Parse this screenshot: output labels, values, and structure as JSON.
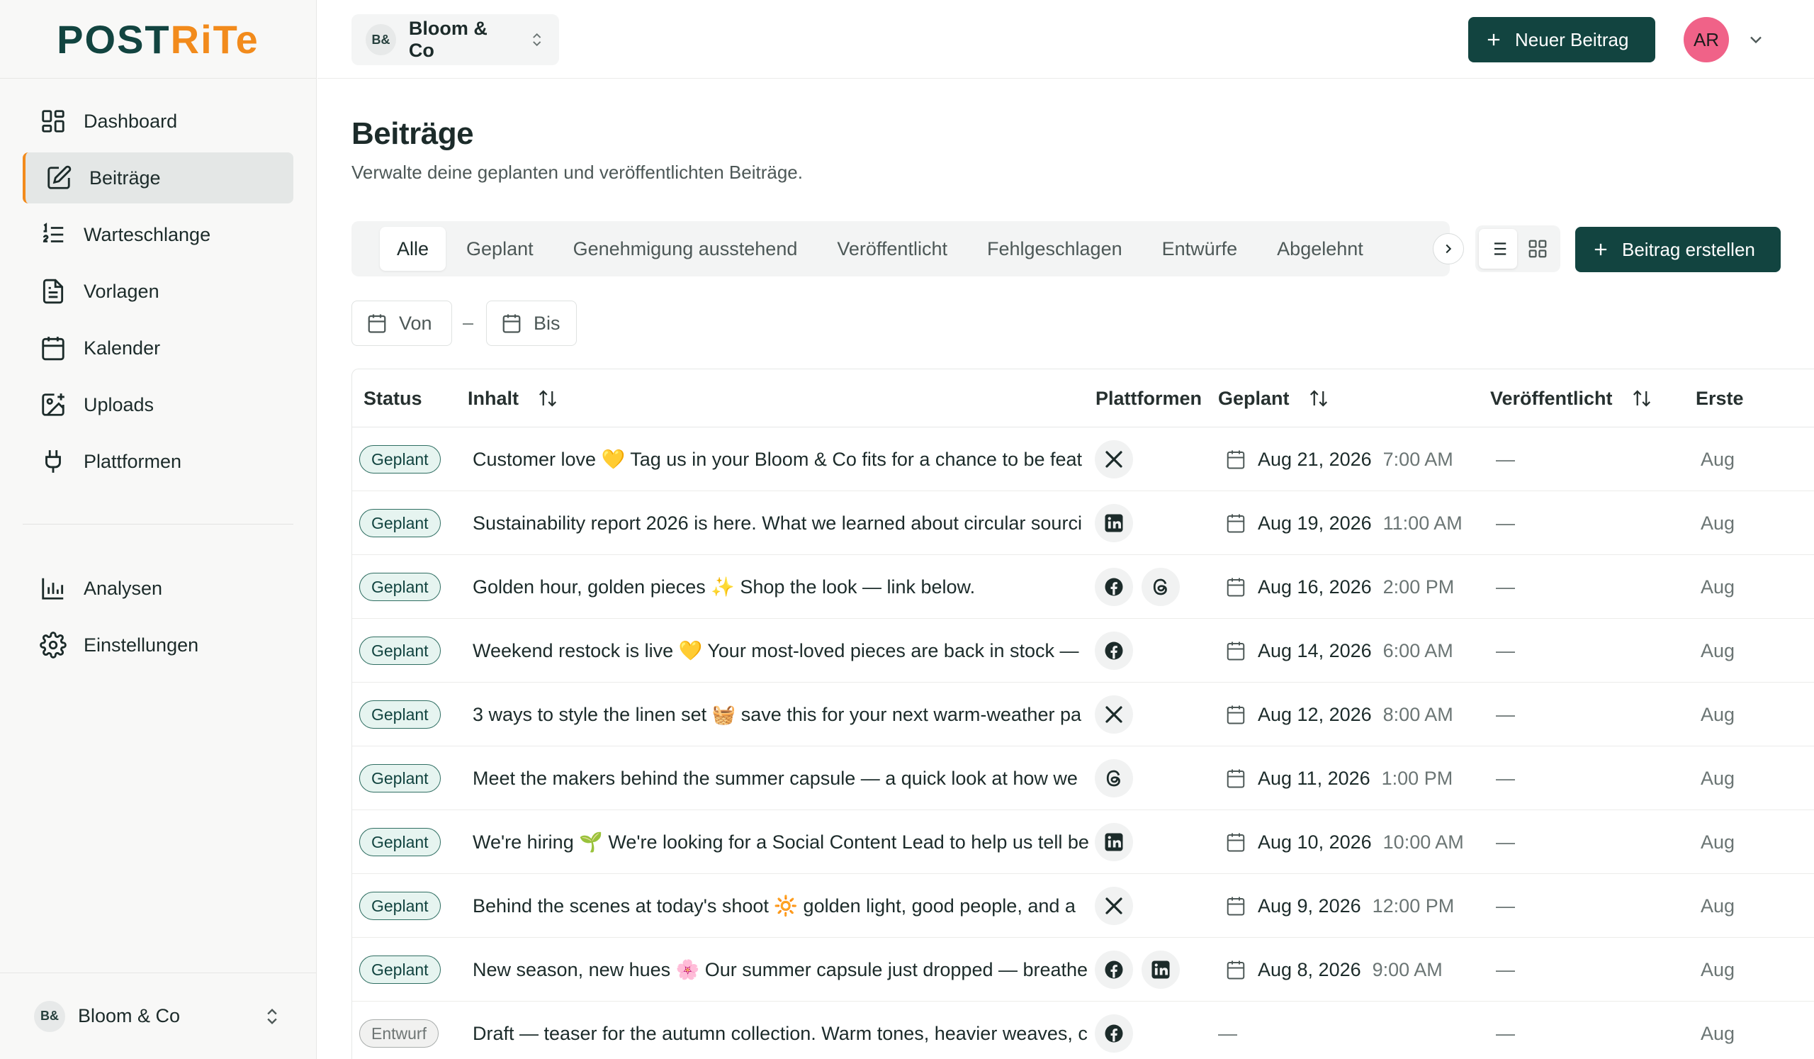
{
  "app": {
    "logo_post": "POST",
    "logo_rite": "RiTe",
    "workspace_badge": "B&",
    "workspace_name": "Bloom & Co"
  },
  "sidebar": {
    "items": [
      {
        "label": "Dashboard",
        "icon": "dashboard-icon"
      },
      {
        "label": "Beiträge",
        "icon": "edit-icon",
        "active": true
      },
      {
        "label": "Warteschlange",
        "icon": "queue-icon"
      },
      {
        "label": "Vorlagen",
        "icon": "document-icon"
      },
      {
        "label": "Kalender",
        "icon": "calendar-icon"
      },
      {
        "label": "Uploads",
        "icon": "image-icon"
      },
      {
        "label": "Plattformen",
        "icon": "plug-icon"
      }
    ],
    "secondary": [
      {
        "label": "Analysen",
        "icon": "chart-icon"
      },
      {
        "label": "Einstellungen",
        "icon": "gear-icon"
      }
    ]
  },
  "header": {
    "new_post_label": "Neuer Beitrag",
    "avatar_initials": "AR"
  },
  "page": {
    "title": "Beiträge",
    "subtitle": "Verwalte deine geplanten und veröffentlichten Beiträge."
  },
  "tabs": [
    "Alle",
    "Geplant",
    "Genehmigung ausstehend",
    "Veröffentlicht",
    "Fehlgeschlagen",
    "Entwürfe",
    "Abgelehnt"
  ],
  "actions": {
    "create_post_label": "Beitrag erstellen"
  },
  "filters": {
    "from_label": "Von",
    "to_label": "Bis",
    "separator": "–"
  },
  "table": {
    "headers": {
      "status": "Status",
      "content": "Inhalt",
      "platforms": "Plattformen",
      "scheduled": "Geplant",
      "published": "Veröffentlicht",
      "created": "Erste"
    },
    "rows": [
      {
        "status": "Geplant",
        "status_type": "scheduled",
        "content": "Customer love 💛  Tag us in your Bloom & Co fits for a chance to be feat",
        "platforms": [
          "x"
        ],
        "date": "Aug 21, 2026",
        "time": "7:00 AM",
        "published": "—",
        "created": "Aug"
      },
      {
        "status": "Geplant",
        "status_type": "scheduled",
        "content": "Sustainability report 2026 is here. What we learned about circular sourci",
        "platforms": [
          "linkedin"
        ],
        "date": "Aug 19, 2026",
        "time": "11:00 AM",
        "published": "—",
        "created": "Aug"
      },
      {
        "status": "Geplant",
        "status_type": "scheduled",
        "content": "Golden hour, golden pieces ✨  Shop the look — link below.",
        "platforms": [
          "facebook",
          "threads"
        ],
        "date": "Aug 16, 2026",
        "time": "2:00 PM",
        "published": "—",
        "created": "Aug"
      },
      {
        "status": "Geplant",
        "status_type": "scheduled",
        "content": "Weekend restock is live 💛  Your most-loved pieces are back in stock —",
        "platforms": [
          "facebook"
        ],
        "date": "Aug 14, 2026",
        "time": "6:00 AM",
        "published": "—",
        "created": "Aug"
      },
      {
        "status": "Geplant",
        "status_type": "scheduled",
        "content": "3 ways to style the linen set 🧺  save this for your next warm-weather pa",
        "platforms": [
          "x"
        ],
        "date": "Aug 12, 2026",
        "time": "8:00 AM",
        "published": "—",
        "created": "Aug"
      },
      {
        "status": "Geplant",
        "status_type": "scheduled",
        "content": "Meet the makers behind the summer capsule — a quick look at how we",
        "platforms": [
          "threads"
        ],
        "date": "Aug 11, 2026",
        "time": "1:00 PM",
        "published": "—",
        "created": "Aug"
      },
      {
        "status": "Geplant",
        "status_type": "scheduled",
        "content": "We're hiring 🌱  We're looking for a Social Content Lead to help us tell be",
        "platforms": [
          "linkedin"
        ],
        "date": "Aug 10, 2026",
        "time": "10:00 AM",
        "published": "—",
        "created": "Aug"
      },
      {
        "status": "Geplant",
        "status_type": "scheduled",
        "content": "Behind the scenes at today's shoot 🔆  golden light, good people, and a",
        "platforms": [
          "x"
        ],
        "date": "Aug 9, 2026",
        "time": "12:00 PM",
        "published": "—",
        "created": "Aug"
      },
      {
        "status": "Geplant",
        "status_type": "scheduled",
        "content": "New season, new hues 🌸  Our summer capsule just dropped — breathe",
        "platforms": [
          "facebook",
          "linkedin"
        ],
        "date": "Aug 8, 2026",
        "time": "9:00 AM",
        "published": "—",
        "created": "Aug"
      },
      {
        "status": "Entwurf",
        "status_type": "draft",
        "content": "Draft — teaser for the autumn collection. Warm tones, heavier weaves, c",
        "platforms": [
          "facebook"
        ],
        "date": "",
        "time": "",
        "scheduled_empty": "—",
        "published": "—",
        "created": "Aug"
      }
    ]
  },
  "colors": {
    "brand": "#124440",
    "accent": "#f28b1c",
    "avatar": "#f06288"
  }
}
